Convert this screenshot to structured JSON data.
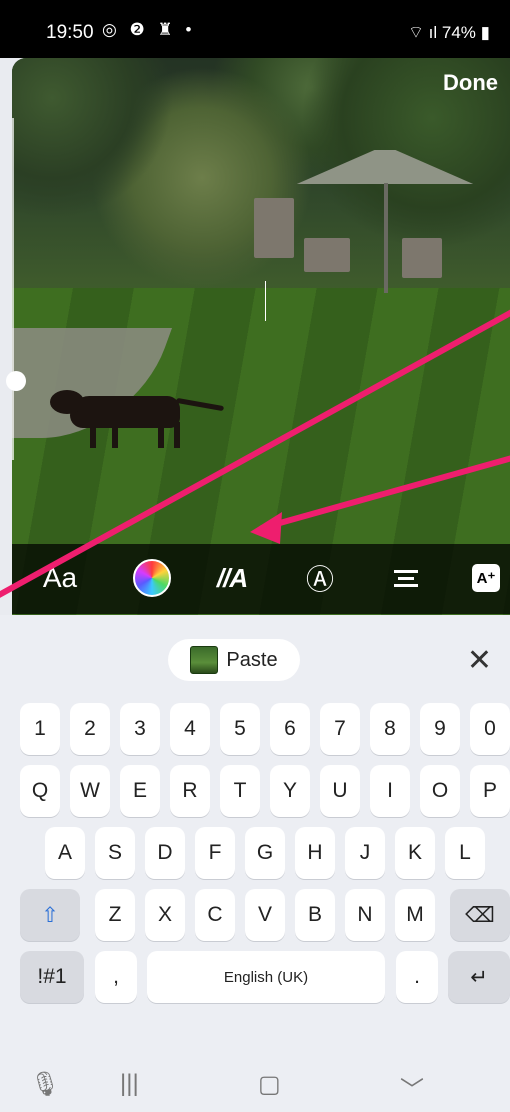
{
  "status_bar": {
    "time": "19:50",
    "notification_icons": "◎ ❷ ♜ •",
    "battery": "74%",
    "signal": "⌔ ıl"
  },
  "editor": {
    "done_label": "Done"
  },
  "toolbar": {
    "font_label": "Aa",
    "effect_label": "//A",
    "animate_label": "Ⓐ",
    "plus_label": "A⁺"
  },
  "keyboard": {
    "paste_label": "Paste",
    "close_label": "✕",
    "number_row": [
      "1",
      "2",
      "3",
      "4",
      "5",
      "6",
      "7",
      "8",
      "9",
      "0"
    ],
    "row1": [
      "Q",
      "W",
      "E",
      "R",
      "T",
      "Y",
      "U",
      "I",
      "O",
      "P"
    ],
    "row2": [
      "A",
      "S",
      "D",
      "F",
      "G",
      "H",
      "J",
      "K",
      "L"
    ],
    "row3": [
      "Z",
      "X",
      "C",
      "V",
      "B",
      "N",
      "M"
    ],
    "shift_label": "⇧",
    "backspace_label": "⌫",
    "symbols_label": "!#1",
    "comma_label": ",",
    "space_label": "English (UK)",
    "period_label": ".",
    "enter_label": "↵"
  },
  "nav_bar": {
    "mic": "🎙",
    "recents": "|||",
    "home": "▢",
    "back": "﹀"
  },
  "colors": {
    "annotation_arrow": "#ee1e6e",
    "keyboard_bg": "#eceef3",
    "toolbar_bg": "#000000"
  }
}
